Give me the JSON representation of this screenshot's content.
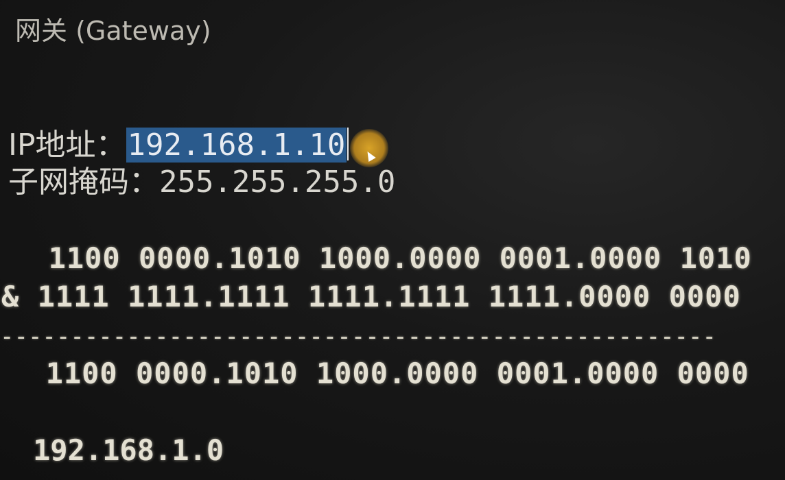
{
  "heading": "网关 (Gateway)",
  "ip": {
    "label": "IP地址：",
    "value": "192.168.1.10"
  },
  "mask": {
    "label": "子网掩码：",
    "value": "255.255.255.0"
  },
  "calculation": {
    "ip_binary": "  1100 0000.1010 1000.0000 0001.0000 1010",
    "mask_binary": "& 1111 1111.1111 1111.1111 1111.0000 0000",
    "divider": "---------------------------------------------------",
    "result_binary": "  1100 0000.1010 1000.0000 0001.0000 0000"
  },
  "network_address": "192.168.1.0",
  "colors": {
    "background": "#141414",
    "text": "#dcd9cf",
    "selection": "#2a5a8c",
    "cursor_highlight": "#e2aa28"
  }
}
